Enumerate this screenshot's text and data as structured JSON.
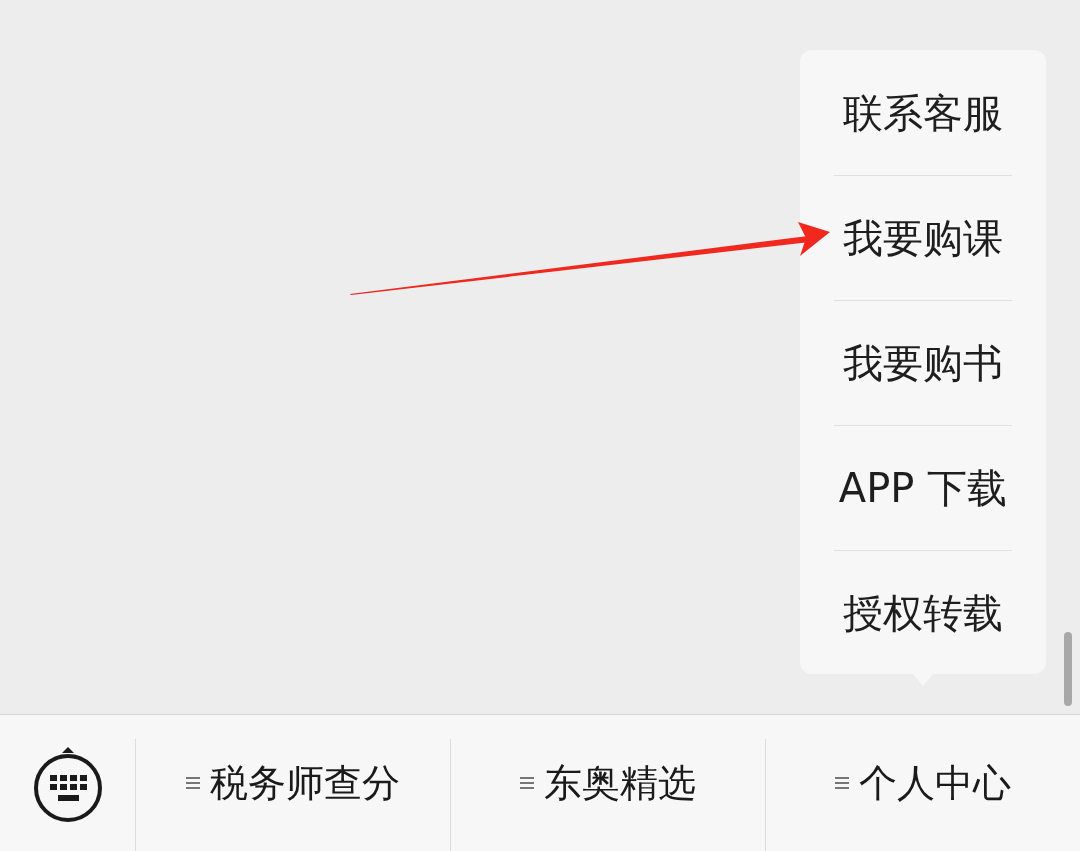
{
  "popup_menu": {
    "items": [
      {
        "label": "联系客服"
      },
      {
        "label": "我要购课"
      },
      {
        "label": "我要购书"
      },
      {
        "label": "APP 下载"
      },
      {
        "label": "授权转载"
      }
    ]
  },
  "bottom_bar": {
    "menus": [
      {
        "label": "税务师查分"
      },
      {
        "label": "东奥精选"
      },
      {
        "label": "个人中心"
      }
    ]
  }
}
